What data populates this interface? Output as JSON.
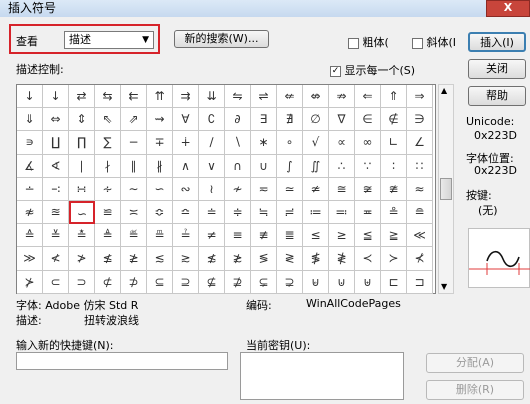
{
  "window": {
    "title": "插入符号",
    "close_label": "X"
  },
  "view": {
    "label": "查看",
    "selected": "描述",
    "new_search_label": "新的搜索(W)...",
    "bold_label": "粗体(",
    "italic_label": "斜体(I",
    "insert_label": "插入(I)"
  },
  "desc_control": {
    "label": "描述控制:",
    "show_each_label": "显示每一个(S)",
    "close_label": "关闭",
    "help_label": "帮助"
  },
  "right_panel": {
    "unicode_label": "Unicode:",
    "unicode_value": "0x223D",
    "glyph_pos_label": "字体位置:",
    "glyph_pos_value": "0x223D",
    "keys_label": "按键:",
    "keys_value": "(无)"
  },
  "grid": {
    "cols": 16,
    "selected_index": 82,
    "symbols": [
      "↓",
      "↓",
      "⇄",
      "⇆",
      "⇇",
      "⇈",
      "⇉",
      "⇊",
      "⇋",
      "⇌",
      "⇍",
      "⇎",
      "⇏",
      "⇐",
      "⇑",
      "⇒",
      "⇓",
      "⇔",
      "⇕",
      "⇖",
      "⇗",
      "⇝",
      "∀",
      "∁",
      "∂",
      "∃",
      "∄",
      "∅",
      "∇",
      "∈",
      "∉",
      "∋",
      "∍",
      "∐",
      "∏",
      "∑",
      "−",
      "∓",
      "∔",
      "∕",
      "∖",
      "∗",
      "∘",
      "√",
      "∝",
      "∞",
      "∟",
      "∠",
      "∡",
      "∢",
      "∣",
      "∤",
      "∥",
      "∦",
      "∧",
      "∨",
      "∩",
      "∪",
      "∫",
      "∬",
      "∴",
      "∵",
      "∶",
      "∷",
      "∸",
      "∹",
      "∺",
      "∻",
      "∼",
      "∽",
      "∾",
      "≀",
      "≁",
      "≂",
      "≃",
      "≄",
      "≅",
      "≆",
      "≇",
      "≈",
      "≉",
      "≊",
      "∽",
      "≌",
      "≍",
      "≎",
      "≏",
      "≐",
      "≑",
      "≒",
      "≓",
      "≔",
      "≕",
      "≖",
      "≗",
      "≘",
      "≙",
      "≚",
      "≛",
      "≜",
      "≝",
      "≞",
      "≟",
      "≠",
      "≡",
      "≢",
      "≣",
      "≤",
      "≥",
      "≦",
      "≧",
      "≪",
      "≫",
      "≮",
      "≯",
      "≰",
      "≱",
      "≲",
      "≳",
      "≴",
      "≵",
      "≶",
      "≷",
      "≸",
      "≹",
      "≺",
      "≻",
      "⊀",
      "⊁",
      "⊂",
      "⊃",
      "⊄",
      "⊅",
      "⊆",
      "⊇",
      "⊈",
      "⊉",
      "⊊",
      "⊋",
      "⊌",
      "⊍",
      "⊎",
      "⊏",
      "⊐"
    ]
  },
  "info": {
    "font_label": "字体: Adobe 仿宋 Std R",
    "encoding_label": "编码:",
    "encoding_value": "WinAllCodePages",
    "desc_label": "描述:",
    "desc_value": "扭转波浪线"
  },
  "shortcut": {
    "new_key_label": "输入新的快捷键(N):",
    "current_key_label": "当前密钥(U):",
    "assign_label": "分配(A)",
    "delete_label": "删除(R)"
  }
}
